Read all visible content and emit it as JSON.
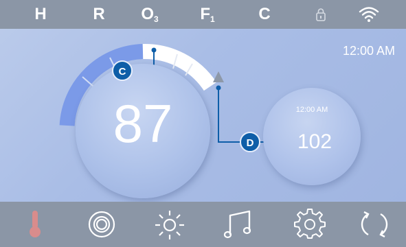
{
  "status_bar": {
    "items": [
      "H",
      "R",
      "O",
      "F",
      "C"
    ],
    "o3_sub": "3",
    "f1_sub": "1",
    "icons": [
      "lock-icon",
      "wifi-icon"
    ]
  },
  "clock": "12:00 AM",
  "temperature": {
    "current": "87",
    "callout": "C"
  },
  "setpoint": {
    "time": "12:00 AM",
    "value": "102",
    "callout": "D"
  },
  "bottom_bar": {
    "icons": [
      "thermometer-icon",
      "jets-icon",
      "light-icon",
      "music-icon",
      "settings-icon",
      "cycle-icon"
    ]
  },
  "colors": {
    "bar": "#8b96a6",
    "arc_filled": "#7b9ae8",
    "arc_range": "#ffffff",
    "callout": "#0e5ea8",
    "thermometer": "#d98c8c"
  }
}
